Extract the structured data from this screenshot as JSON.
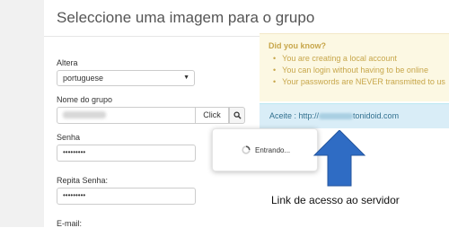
{
  "page": {
    "title": "Seleccione uma imagem para o grupo"
  },
  "form": {
    "language_label": "Altera",
    "language_value": "portuguese",
    "group_name_label": "Nome do grupo",
    "click_button": "Click",
    "password_label": "Senha",
    "password_value": "•••••••••",
    "repeat_password_label": "Repita Senha:",
    "repeat_password_value": "•••••••••",
    "email_label": "E-mail:"
  },
  "info": {
    "title": "Did you know?",
    "items": [
      "You are creating a local account",
      "You can login without having to be online",
      "Your passwords are NEVER transmitted to us"
    ]
  },
  "access": {
    "prefix": "Aceite : http://",
    "suffix": "tonidoid.com"
  },
  "loading": {
    "text": "Entrando..."
  },
  "annotation": {
    "caption": "Link de acesso ao servidor"
  },
  "colors": {
    "info_bg": "#fcf8e3",
    "info_text": "#c7a64a",
    "access_bg": "#d9edf7",
    "access_text": "#31708f",
    "arrow": "#2f6cc4"
  }
}
